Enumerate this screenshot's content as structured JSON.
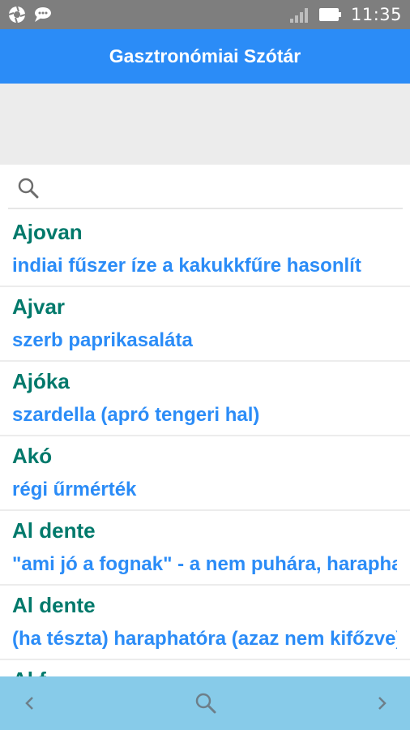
{
  "status_bar": {
    "time": "11:35",
    "icons": [
      "aperture-icon",
      "chat-bubble-icon",
      "signal-icon",
      "battery-icon"
    ]
  },
  "app_bar": {
    "title": "Gasztronómiai Szótár"
  },
  "search": {
    "placeholder": "",
    "value": ""
  },
  "entries": [
    {
      "term": "Ajovan",
      "definition": "indiai fűszer íze a kakukkfűre hasonlít"
    },
    {
      "term": "Ajvar",
      "definition": "szerb paprikasaláta"
    },
    {
      "term": "Ajóka",
      "definition": "szardella (apró tengeri hal)"
    },
    {
      "term": "Akó",
      "definition": "régi űrmérték"
    },
    {
      "term": "Al dente",
      "definition": "\"ami jó a fognak\" - a nem puhára, harapható"
    },
    {
      "term": "Al dente",
      "definition": "(ha tészta) haraphatóra (azaz nem kifőzve)"
    },
    {
      "term": "Al f...",
      "definition": ""
    }
  ],
  "bottom_nav": {
    "prev_icon": "chevron-left-icon",
    "search_icon": "search-icon",
    "next_icon": "chevron-right-icon"
  },
  "colors": {
    "status_bar": "#7e7e7e",
    "app_bar": "#2b8cf7",
    "term": "#00796b",
    "definition": "#2b8cf7",
    "bottom_nav": "#87cbe9"
  }
}
